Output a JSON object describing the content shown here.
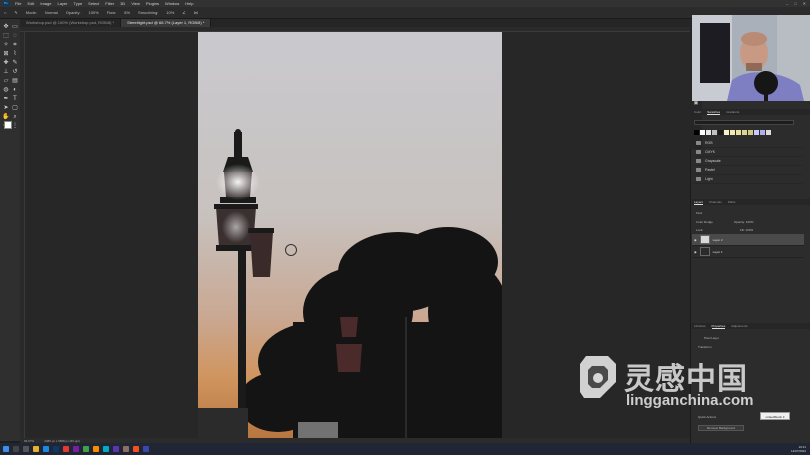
{
  "menubar": {
    "items": [
      "File",
      "Edit",
      "Image",
      "Layer",
      "Type",
      "Select",
      "Filter",
      "3D",
      "View",
      "Plugins",
      "Window",
      "Help"
    ]
  },
  "options": {
    "mode_label": "Mode:",
    "mode_value": "Normal",
    "opacity_label": "Opacity:",
    "opacity_value": "100%",
    "flow_label": "Flow:",
    "flow_value": "8%",
    "smoothing_label": "Smoothing:",
    "smoothing_value": "10%"
  },
  "tabs": [
    {
      "label": "Workshop.psd @ 100% (Workshop.psd, RGB/8) *"
    },
    {
      "label": "Streetlight.psd @ 66.7% (Layer 1, RGB/8) *"
    }
  ],
  "status": {
    "zoom": "66.67%",
    "doc_info": "2480 px x 3508 px (96 ppi)"
  },
  "panel": {
    "color_tabs": [
      "Color",
      "Swatches",
      "Gradients"
    ],
    "swatch_folders": [
      "RGB",
      "CMYK",
      "Grayscale",
      "Pastel",
      "Light"
    ],
    "layers_tabs": [
      "Layers",
      "Channels",
      "Paths"
    ],
    "kind_label": "Kind",
    "blend_value": "Color Dodge",
    "opacity_label": "Opacity: 100%",
    "fill_label": "Fill: 100%",
    "lock_label": "Lock:",
    "layers": [
      {
        "name": "Layer 2",
        "selected": true
      },
      {
        "name": "Layer 1",
        "selected": false
      }
    ],
    "props_tabs": [
      "Libraries",
      "Properties",
      "Adjustments"
    ],
    "props_title": "Pixel Layer",
    "props_section": "Transform",
    "quick_actions": "Quick Actions",
    "remove_bg": "Remove Background",
    "tooltip": "LinkedStock 3"
  },
  "taskbar": {
    "time": "10:21",
    "date": "14/07/2022"
  },
  "watermark": {
    "cn": "灵感中国",
    "url": "lingganchina.com"
  },
  "colors": {
    "accent": "#31a8ff",
    "watermark_orange": "#e07a20"
  }
}
